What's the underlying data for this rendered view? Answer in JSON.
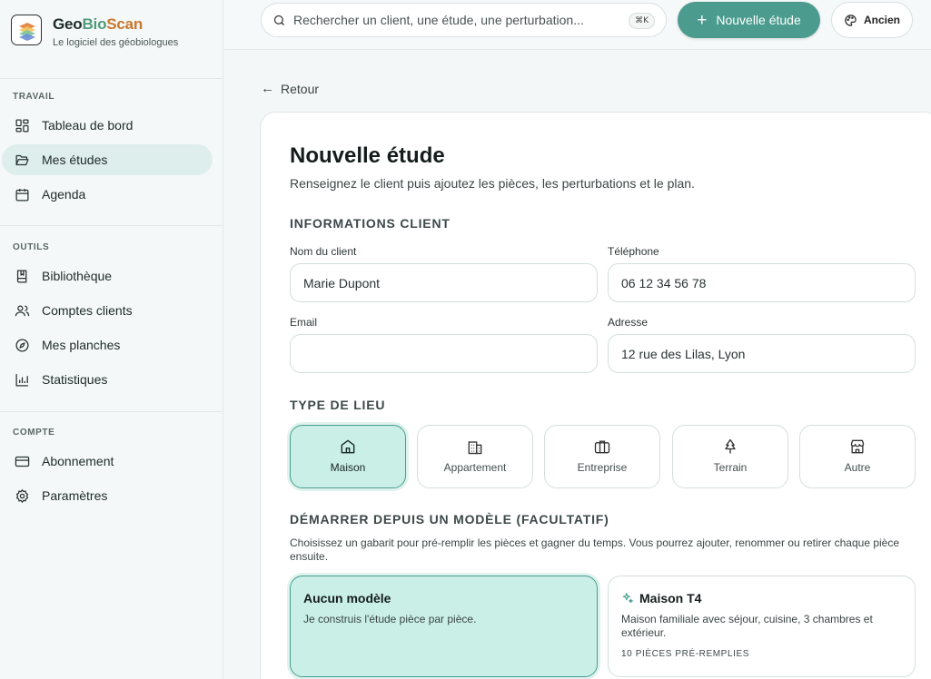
{
  "brand": {
    "name_part1": "Geo",
    "name_part2": "Bio",
    "name_part3": "Scan",
    "tagline": "Le logiciel des géobiologues"
  },
  "sidebar": {
    "sections": [
      {
        "label": "TRAVAIL",
        "items": [
          {
            "label": "Tableau de bord",
            "icon": "grid-icon"
          },
          {
            "label": "Mes études",
            "icon": "folder-open-icon",
            "active": true
          },
          {
            "label": "Agenda",
            "icon": "calendar-icon"
          }
        ]
      },
      {
        "label": "OUTILS",
        "items": [
          {
            "label": "Bibliothèque",
            "icon": "book-icon"
          },
          {
            "label": "Comptes clients",
            "icon": "users-icon"
          },
          {
            "label": "Mes planches",
            "icon": "compass-icon"
          },
          {
            "label": "Statistiques",
            "icon": "bar-chart-icon"
          }
        ]
      },
      {
        "label": "COMPTE",
        "items": [
          {
            "label": "Abonnement",
            "icon": "credit-card-icon"
          },
          {
            "label": "Paramètres",
            "icon": "gear-icon"
          }
        ]
      }
    ]
  },
  "topbar": {
    "search_placeholder": "Rechercher un client, une étude, une perturbation...",
    "shortcut": "⌘K",
    "new_study_label": "Nouvelle étude",
    "theme_label": "Ancien"
  },
  "main": {
    "back_label": "Retour",
    "title": "Nouvelle étude",
    "subtitle": "Renseignez le client puis ajoutez les pièces, les perturbations et le plan.",
    "client_section": "INFORMATIONS CLIENT",
    "fields": {
      "name_label": "Nom du client",
      "name_value": "Marie Dupont",
      "phone_label": "Téléphone",
      "phone_value": "06 12 34 56 78",
      "email_label": "Email",
      "email_value": "",
      "address_label": "Adresse",
      "address_value": "12 rue des Lilas, Lyon"
    },
    "place_section": "TYPE DE LIEU",
    "place_types": [
      {
        "label": "Maison",
        "icon": "house-icon",
        "selected": true
      },
      {
        "label": "Appartement",
        "icon": "building-icon"
      },
      {
        "label": "Entreprise",
        "icon": "briefcase-icon"
      },
      {
        "label": "Terrain",
        "icon": "tree-icon"
      },
      {
        "label": "Autre",
        "icon": "store-icon"
      }
    ],
    "template_section": "DÉMARRER DEPUIS UN MODÈLE (FACULTATIF)",
    "template_description": "Choisissez un gabarit pour pré-remplir les pièces et gagner du temps. Vous pourrez ajouter, renommer ou retirer chaque pièce ensuite.",
    "templates": [
      {
        "title": "Aucun modèle",
        "body": "Je construis l'étude pièce par pièce.",
        "selected": true
      },
      {
        "title": "Maison T4",
        "body": "Maison familiale avec séjour, cuisine, 3 chambres et extérieur.",
        "count": "10 PIÈCES PRÉ-REMPLIES",
        "icon": "sparkle-icon"
      }
    ]
  },
  "colors": {
    "accent": "#4b9c8e",
    "accent_light": "#c9efe7",
    "active_nav": "#ddeeec",
    "brand_bio": "#4e9a7a",
    "brand_scan": "#c9772c"
  }
}
